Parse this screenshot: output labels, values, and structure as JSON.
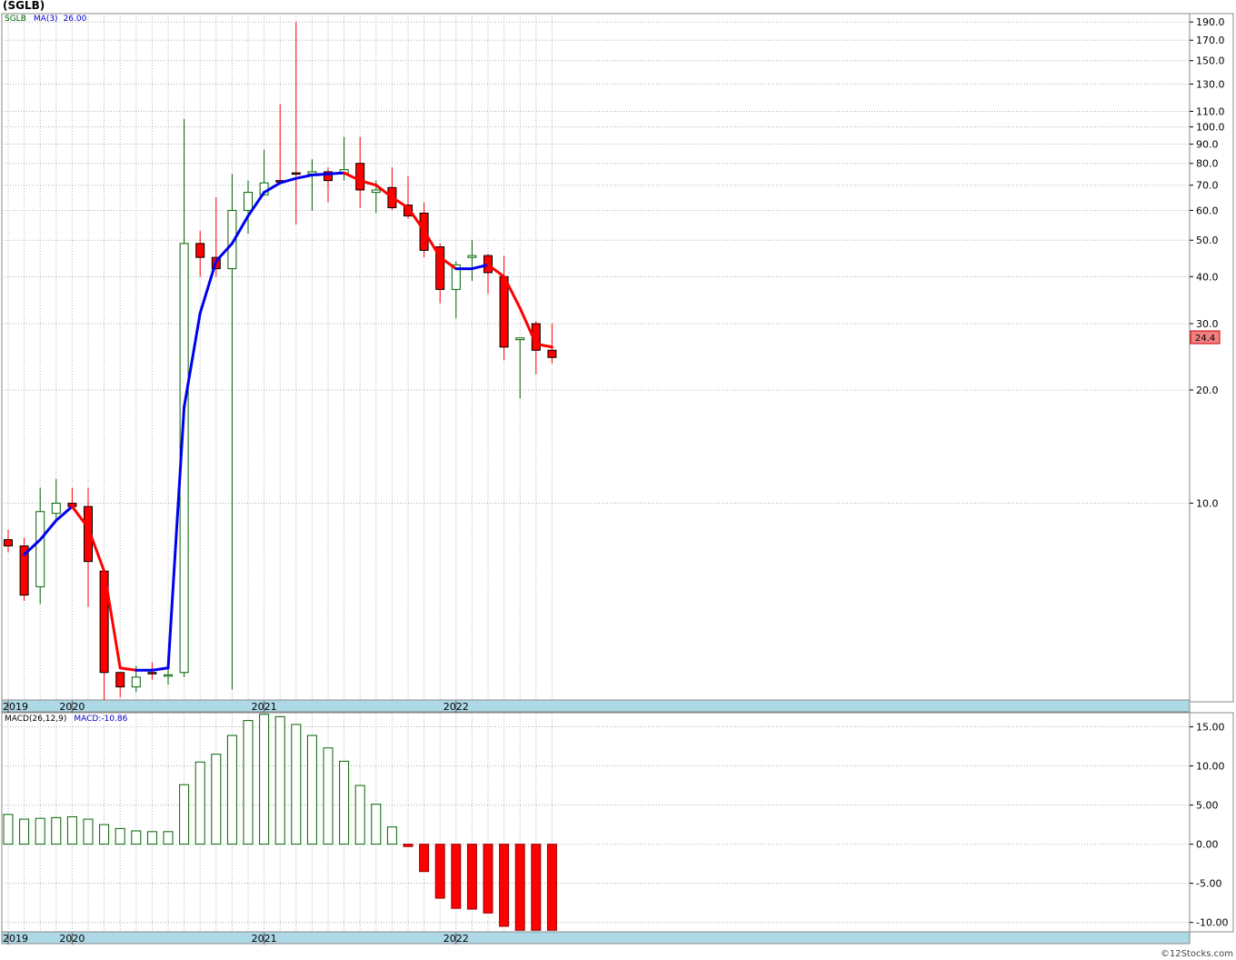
{
  "page": {
    "title": "(SGLB)",
    "watermark": "©12Stocks.com"
  },
  "price_panel": {
    "legend": {
      "symbol": "SGLB",
      "ma_label": "MA(3)",
      "ma_value": "26.00"
    },
    "last_price_label": "24.4",
    "colors": {
      "up": "#006400",
      "down": "#ff0000",
      "ma_up": "#0000ee",
      "ma_down": "#ff0000",
      "grid": "#b0b0b0"
    }
  },
  "macd_panel": {
    "legend": {
      "label": "MACD(26,12,9)",
      "value_label": "MACD:-10.86"
    }
  },
  "chart_data": [
    {
      "type": "candlestick",
      "title": "(SGLB)",
      "series": [
        {
          "name": "SGLB"
        }
      ],
      "y_scale": "log",
      "ylim": [
        3.0,
        200.0
      ],
      "y_ticks": [
        10,
        20,
        30,
        40,
        50,
        60,
        70,
        80,
        90,
        100,
        110,
        130,
        150,
        170,
        190
      ],
      "y_tick_labels": [
        "10.0",
        "20.0",
        "30.0",
        "40.0",
        "50.0",
        "60.0",
        "70.0",
        "80.0",
        "90.0",
        "100.0",
        "110.0",
        "130.0",
        "150.0",
        "170.0",
        "190.0"
      ],
      "x_labels": [
        {
          "label": "2019",
          "index": 0
        },
        {
          "label": "2020",
          "index": 4
        },
        {
          "label": "2021",
          "index": 16
        },
        {
          "label": "2022",
          "index": 28
        }
      ],
      "candles": [
        {
          "open": 8.0,
          "high": 8.5,
          "low": 7.4,
          "close": 7.7
        },
        {
          "open": 7.7,
          "high": 8.1,
          "low": 5.5,
          "close": 5.7
        },
        {
          "open": 6.0,
          "high": 11.0,
          "low": 5.4,
          "close": 9.5
        },
        {
          "open": 9.4,
          "high": 11.6,
          "low": 9.0,
          "close": 10.0
        },
        {
          "open": 10.0,
          "high": 11.0,
          "low": 9.7,
          "close": 9.8
        },
        {
          "open": 9.8,
          "high": 11.0,
          "low": 5.3,
          "close": 7.0
        },
        {
          "open": 6.6,
          "high": 6.7,
          "low": 3.0,
          "close": 3.55
        },
        {
          "open": 3.55,
          "high": 3.55,
          "low": 3.05,
          "close": 3.25
        },
        {
          "open": 3.25,
          "high": 3.7,
          "low": 3.15,
          "close": 3.45
        },
        {
          "open": 3.55,
          "high": 3.78,
          "low": 3.4,
          "close": 3.52
        },
        {
          "open": 3.48,
          "high": 3.66,
          "low": 3.3,
          "close": 3.5
        },
        {
          "open": 3.55,
          "high": 105.0,
          "low": 3.45,
          "close": 49.0
        },
        {
          "open": 49.0,
          "high": 53.0,
          "low": 40.0,
          "close": 45.0
        },
        {
          "open": 45.0,
          "high": 65.0,
          "low": 40.0,
          "close": 42.0
        },
        {
          "open": 42.0,
          "high": 75.0,
          "low": 3.2,
          "close": 60.0
        },
        {
          "open": 60.0,
          "high": 72.0,
          "low": 52.0,
          "close": 67.0
        },
        {
          "open": 66.0,
          "high": 87.0,
          "low": 67.0,
          "close": 71.0
        },
        {
          "open": 72.0,
          "high": 115.0,
          "low": 72.0,
          "close": 71.5
        },
        {
          "open": 75.5,
          "high": 190.0,
          "low": 55.0,
          "close": 75.0
        },
        {
          "open": 75.0,
          "high": 82.0,
          "low": 60.0,
          "close": 76.0
        },
        {
          "open": 76.0,
          "high": 78.0,
          "low": 63.0,
          "close": 72.0
        },
        {
          "open": 75.0,
          "high": 94.0,
          "low": 72.0,
          "close": 77.0
        },
        {
          "open": 80.0,
          "high": 94.0,
          "low": 61.0,
          "close": 68.0
        },
        {
          "open": 67.0,
          "high": 72.0,
          "low": 59.0,
          "close": 68.0
        },
        {
          "open": 69.0,
          "high": 78.0,
          "low": 60.0,
          "close": 61.0
        },
        {
          "open": 62.0,
          "high": 74.0,
          "low": 57.0,
          "close": 58.0
        },
        {
          "open": 59.0,
          "high": 63.0,
          "low": 45.0,
          "close": 47.0
        },
        {
          "open": 48.0,
          "high": 49.0,
          "low": 34.0,
          "close": 37.0
        },
        {
          "open": 37.0,
          "high": 44.0,
          "low": 31.0,
          "close": 43.0
        },
        {
          "open": 45.0,
          "high": 50.0,
          "low": 39.0,
          "close": 45.5
        },
        {
          "open": 45.5,
          "high": 46.0,
          "low": 36.0,
          "close": 41.0
        },
        {
          "open": 40.0,
          "high": 45.5,
          "low": 24.0,
          "close": 26.0
        },
        {
          "open": 27.2,
          "high": 27.5,
          "low": 19.0,
          "close": 27.5
        },
        {
          "open": 30.0,
          "high": 30.5,
          "low": 22.0,
          "close": 25.5
        },
        {
          "open": 25.5,
          "high": 30.0,
          "low": 23.5,
          "close": 24.4
        }
      ],
      "ma": {
        "name": "MA(3)",
        "values": [
          null,
          7.3,
          8.0,
          9.0,
          9.8,
          8.6,
          6.6,
          3.65,
          3.6,
          3.6,
          3.65,
          18.0,
          32.0,
          44.0,
          49.0,
          58.0,
          67.0,
          71.0,
          73.0,
          74.5,
          75.0,
          75.5,
          72.0,
          70.0,
          65.0,
          61.0,
          53.0,
          45.0,
          42.0,
          42.0,
          43.0,
          40.0,
          33.0,
          26.5,
          26.0
        ]
      }
    },
    {
      "type": "bar",
      "title": "MACD(26,12,9)",
      "series": [
        {
          "name": "MACD"
        }
      ],
      "ylim": [
        -11.2,
        16.8
      ],
      "y_ticks": [
        15,
        10,
        5,
        0,
        -5,
        -10
      ],
      "y_tick_labels": [
        "15.00",
        "10.00",
        "5.00",
        "0.00",
        "-5.00",
        "-10.00"
      ],
      "x_labels": [
        {
          "label": "2019",
          "index": 0
        },
        {
          "label": "2020",
          "index": 4
        },
        {
          "label": "2021",
          "index": 16
        },
        {
          "label": "2022",
          "index": 28
        }
      ],
      "values": [
        3.8,
        3.2,
        3.3,
        3.4,
        3.5,
        3.2,
        2.5,
        2.0,
        1.7,
        1.6,
        1.6,
        7.6,
        10.5,
        11.5,
        13.9,
        15.8,
        16.6,
        16.3,
        15.3,
        13.9,
        12.3,
        10.6,
        7.5,
        5.1,
        2.2,
        -0.3,
        -3.5,
        -6.9,
        -8.2,
        -8.3,
        -8.8,
        -10.5,
        -11.0,
        -11.0,
        -11.0
      ]
    }
  ]
}
